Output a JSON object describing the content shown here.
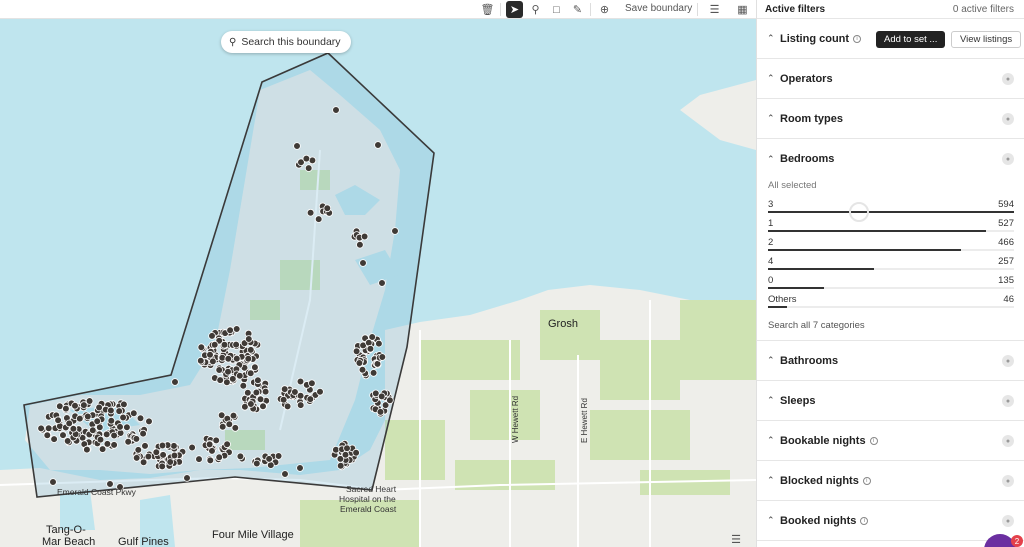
{
  "toolbar": {
    "save_label": "Save boundary",
    "icons": [
      "trash-icon",
      "pointer-icon",
      "pin-icon",
      "crop-icon",
      "pencil-icon",
      "plus-circle-icon",
      "layers-icon",
      "map-icon"
    ],
    "active_tool": "pointer-icon"
  },
  "map": {
    "search_button": "Search this boundary",
    "labels": {
      "grosh": "Grosh",
      "tango_line1": "Tang-O-",
      "tango_line2": "Mar Beach",
      "gulf_pines": "Gulf Pines",
      "four_mile": "Four Mile Village",
      "emerald_coast": "Emerald Coast Pkwy",
      "sacred_heart_1": "Sacred Heart",
      "sacred_heart_2": "Hospital on the",
      "sacred_heart_3": "Emerald Coast",
      "w_hewett": "W Hewett Rd",
      "e_hewett": "E Hewett Rd"
    },
    "colors": {
      "water": "#bfe5ee",
      "land": "#eeeeea",
      "green": "#cfe3b3",
      "pin": "#3f3a36",
      "boundary": "#3a3a3a"
    }
  },
  "panel": {
    "header_title": "Active filters",
    "header_count": "0 active filters",
    "listing_count": {
      "label": "Listing count",
      "add_button": "Add to set ...",
      "view_button": "View listings"
    },
    "sections_before": [
      {
        "label": "Operators"
      },
      {
        "label": "Room types"
      }
    ],
    "bedrooms": {
      "label": "Bedrooms",
      "all_selected": "All selected",
      "rows": [
        {
          "category": "3",
          "count": "594",
          "value": 594
        },
        {
          "category": "1",
          "count": "527",
          "value": 527
        },
        {
          "category": "2",
          "count": "466",
          "value": 466
        },
        {
          "category": "4",
          "count": "257",
          "value": 257
        },
        {
          "category": "0",
          "count": "135",
          "value": 135
        },
        {
          "category": "Others",
          "count": "46",
          "value": 46
        }
      ],
      "search_categories": "Search all 7 categories"
    },
    "sections_after": [
      {
        "label": "Bathrooms",
        "info": false
      },
      {
        "label": "Sleeps",
        "info": false
      },
      {
        "label": "Bookable nights",
        "info": true
      },
      {
        "label": "Blocked nights",
        "info": true
      },
      {
        "label": "Booked nights",
        "info": true
      }
    ]
  },
  "chat": {
    "badge": "2"
  }
}
